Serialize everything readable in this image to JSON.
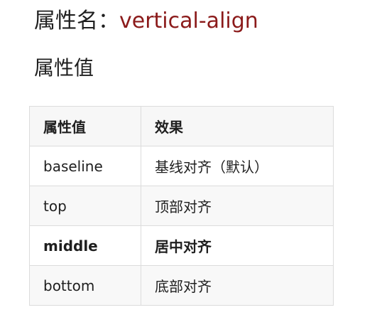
{
  "heading": {
    "label": "属性名：",
    "property": "vertical-align"
  },
  "subheading": "属性值",
  "table": {
    "headers": [
      "属性值",
      "效果"
    ],
    "rows": [
      {
        "value": "baseline",
        "effect": "基线对齐（默认）"
      },
      {
        "value": "top",
        "effect": "顶部对齐"
      },
      {
        "value": "middle",
        "effect": "居中对齐"
      },
      {
        "value": "bottom",
        "effect": "底部对齐"
      }
    ]
  },
  "colors": {
    "property_name": "#8b1a1a",
    "text": "#1f1f1f",
    "border": "#dcdcdc"
  }
}
